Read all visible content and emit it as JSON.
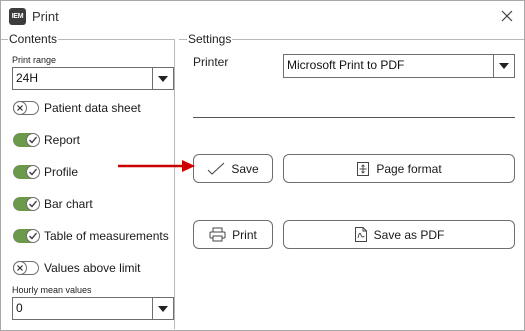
{
  "window": {
    "title": "Print",
    "logo_text": "IEM"
  },
  "contents": {
    "group_label": "Contents",
    "print_range": {
      "label": "Print range",
      "value": "24H"
    },
    "toggles": [
      {
        "label": "Patient data sheet",
        "on": false
      },
      {
        "label": "Report",
        "on": true
      },
      {
        "label": "Profile",
        "on": true
      },
      {
        "label": "Bar chart",
        "on": true
      },
      {
        "label": "Table of measurements",
        "on": true
      },
      {
        "label": "Values above limit",
        "on": false
      }
    ],
    "hourly_mean": {
      "label": "Hourly mean values",
      "value": "0"
    }
  },
  "settings": {
    "group_label": "Settings",
    "printer_label": "Printer",
    "printer_value": "Microsoft Print to PDF",
    "buttons": {
      "save": "Save",
      "page_format": "Page format",
      "print": "Print",
      "save_as_pdf": "Save as PDF"
    }
  },
  "colors": {
    "toggle_on": "#6d9a4a",
    "annotation_arrow": "#cc0000"
  },
  "icons": [
    "app-logo",
    "close-icon",
    "chevron-down-icon",
    "check-icon",
    "x-icon",
    "checkmark-save-icon",
    "page-format-icon",
    "printer-icon",
    "pdf-document-icon",
    "red-arrow-annotation"
  ]
}
